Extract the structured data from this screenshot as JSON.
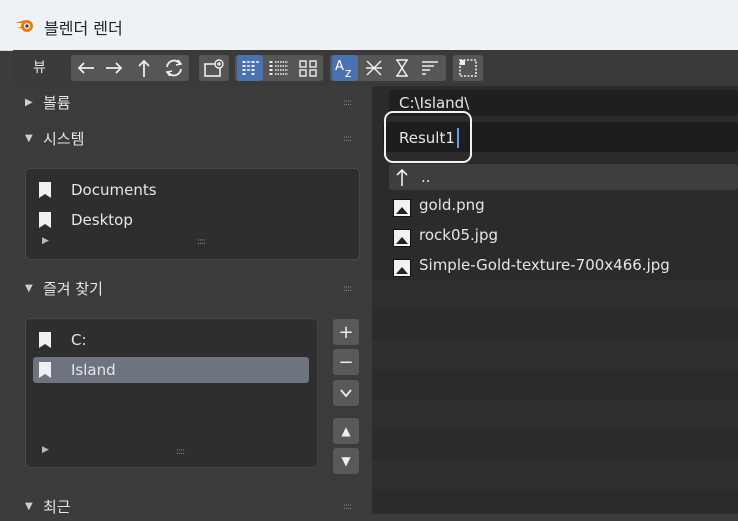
{
  "window": {
    "title": "블렌더 렌더"
  },
  "toolbar": {
    "view_label": "뷰",
    "icons": [
      "back-arrow-icon",
      "forward-arrow-icon",
      "parent-dir-icon",
      "refresh-icon",
      "new-folder-icon",
      "display-vertical-list-icon",
      "display-horizontal-list-icon",
      "display-thumbnails-icon",
      "sort-alpha-icon",
      "sort-extension-icon",
      "sort-time-icon",
      "sort-size-icon",
      "hidden-files-icon"
    ]
  },
  "sidebar": {
    "volumes": {
      "label": "볼륨"
    },
    "system": {
      "label": "시스템",
      "items": [
        {
          "label": "Documents"
        },
        {
          "label": "Desktop"
        }
      ]
    },
    "favorites": {
      "label": "즐겨 찾기",
      "items": [
        {
          "label": "C:"
        },
        {
          "label": "Island"
        }
      ],
      "buttons": {
        "add": "+",
        "remove": "−",
        "menu": "⌄",
        "up": "▲",
        "down": "▼"
      }
    },
    "recent": {
      "label": "최근"
    }
  },
  "main": {
    "path": "C:\\Island\\",
    "filename": "Result1",
    "parent_label": "..",
    "files": [
      {
        "name": "gold.png"
      },
      {
        "name": "rock05.jpg"
      },
      {
        "name": "Simple-Gold-texture-700x466.jpg"
      }
    ]
  }
}
